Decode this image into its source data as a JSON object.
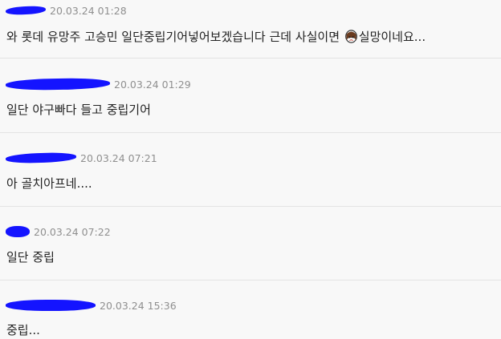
{
  "comments": [
    {
      "timestamp": "20.03.24 01:28",
      "text_before": "와 롯데 유망주 고승민 일단중립기어넣어보겠습니다 근데 사실이면 ",
      "text_after": "실망이네요...",
      "icon": "sad-face-icon"
    },
    {
      "timestamp": "20.03.24 01:29",
      "text": "일단 야구빠다 들고 중립기어"
    },
    {
      "timestamp": "20.03.24 07:21",
      "text": "아 골치아프네...."
    },
    {
      "timestamp": "20.03.24 07:22",
      "text": "일단 중립"
    },
    {
      "timestamp": "20.03.24 15:36",
      "text": "중립..."
    }
  ],
  "colors": {
    "redaction": "#1414ff",
    "timestamp": "#8f8f8f",
    "text": "#222222",
    "divider": "#e3e3e3"
  }
}
